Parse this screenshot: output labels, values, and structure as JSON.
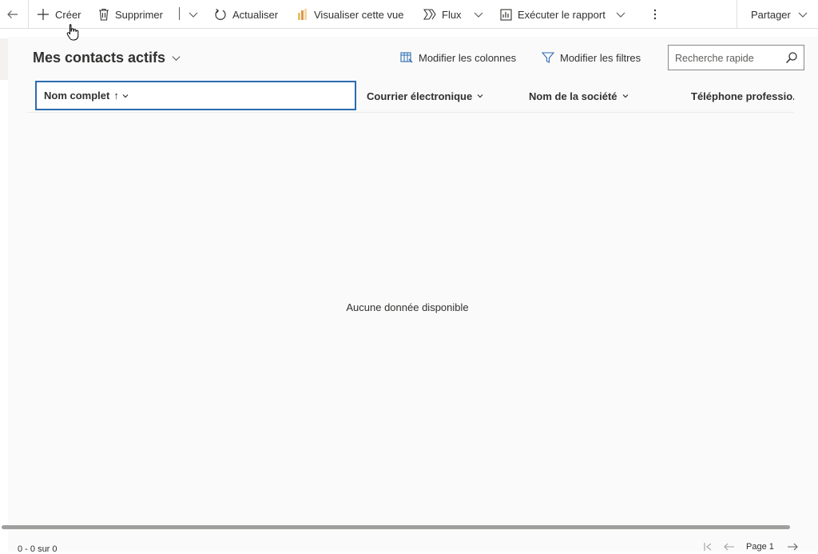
{
  "toolbar": {
    "create_label": "Créer",
    "delete_label": "Supprimer",
    "refresh_label": "Actualiser",
    "visualize_label": "Visualiser cette vue",
    "flow_label": "Flux",
    "report_label": "Exécuter le rapport",
    "share_label": "Partager"
  },
  "view": {
    "title": "Mes contacts actifs",
    "edit_columns_label": "Modifier les colonnes",
    "edit_filters_label": "Modifier les filtres",
    "search_placeholder": "Recherche rapide"
  },
  "grid": {
    "columns": [
      {
        "label": "Nom complet",
        "sort": "↑"
      },
      {
        "label": "Courrier électronique"
      },
      {
        "label": "Nom de la société"
      },
      {
        "label": "Téléphone professio.."
      }
    ],
    "empty_message": "Aucune donnée disponible"
  },
  "footer": {
    "count_text": "0 - 0 sur 0",
    "page_label": "Page 1"
  },
  "colors": {
    "accent": "#2b6cb0",
    "text": "#323130",
    "border": "#e1dfdd",
    "background": "#fafafa"
  }
}
